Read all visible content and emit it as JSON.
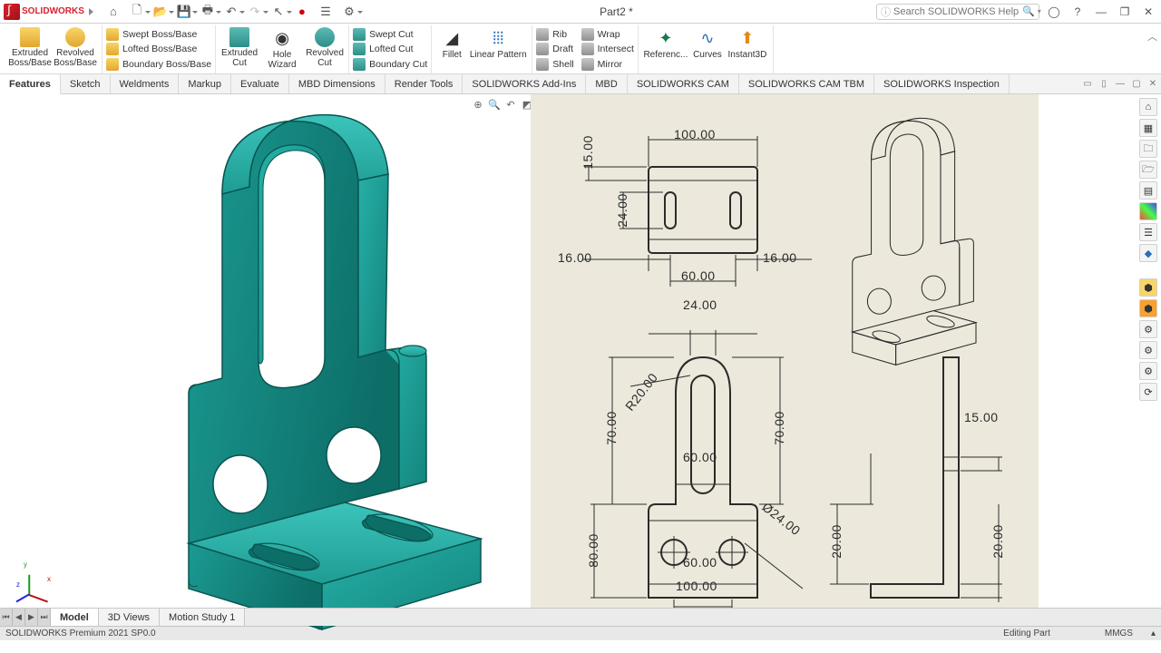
{
  "app": {
    "name_pre": "SOLID",
    "name_post": "WORKS",
    "doc_title": "Part2 *"
  },
  "search": {
    "placeholder": "Search SOLIDWORKS Help"
  },
  "qat": [
    "home",
    "new",
    "open",
    "save",
    "print",
    "undo",
    "redo",
    "select",
    "rebuild",
    "options",
    "settings"
  ],
  "ribbon": {
    "extr_boss": "Extruded\nBoss/Base",
    "rev_boss": "Revolved\nBoss/Base",
    "swept_boss": "Swept Boss/Base",
    "lofted_boss": "Lofted Boss/Base",
    "boundary_boss": "Boundary Boss/Base",
    "extr_cut": "Extruded\nCut",
    "hole_wiz": "Hole Wizard",
    "rev_cut": "Revolved\nCut",
    "swept_cut": "Swept Cut",
    "lofted_cut": "Lofted Cut",
    "boundary_cut": "Boundary Cut",
    "fillet": "Fillet",
    "lin_pat": "Linear Pattern",
    "rib": "Rib",
    "draft": "Draft",
    "shell": "Shell",
    "wrap": "Wrap",
    "intersect": "Intersect",
    "mirror": "Mirror",
    "ref_geom": "Referenc...",
    "curves": "Curves",
    "instant3d": "Instant3D"
  },
  "tabs": [
    "Features",
    "Sketch",
    "Weldments",
    "Markup",
    "Evaluate",
    "MBD Dimensions",
    "Render Tools",
    "SOLIDWORKS Add-Ins",
    "MBD",
    "SOLIDWORKS CAM",
    "SOLIDWORKS CAM TBM",
    "SOLIDWORKS Inspection"
  ],
  "dims": {
    "d100_top": "100.00",
    "d15": "15.00",
    "d24_v": "24.00",
    "d16_l": "16.00",
    "d16_r": "16.00",
    "d60_top": "60.00",
    "d24_top": "24.00",
    "r20": "R20.00",
    "d70_l": "70.00",
    "d70_r": "70.00",
    "d80": "80.00",
    "d60_mid": "60.00",
    "d60_bot": "60.00",
    "d100_bot": "100.00",
    "dia24": "Ø24.00",
    "d15_side": "15.00",
    "d20_l": "20.00",
    "d20_r": "20.00"
  },
  "bottom_tabs": [
    "Model",
    "3D Views",
    "Motion Study 1"
  ],
  "status": {
    "left": "SOLIDWORKS Premium 2021 SP0.0",
    "mode": "Editing Part",
    "units": "MMGS"
  }
}
